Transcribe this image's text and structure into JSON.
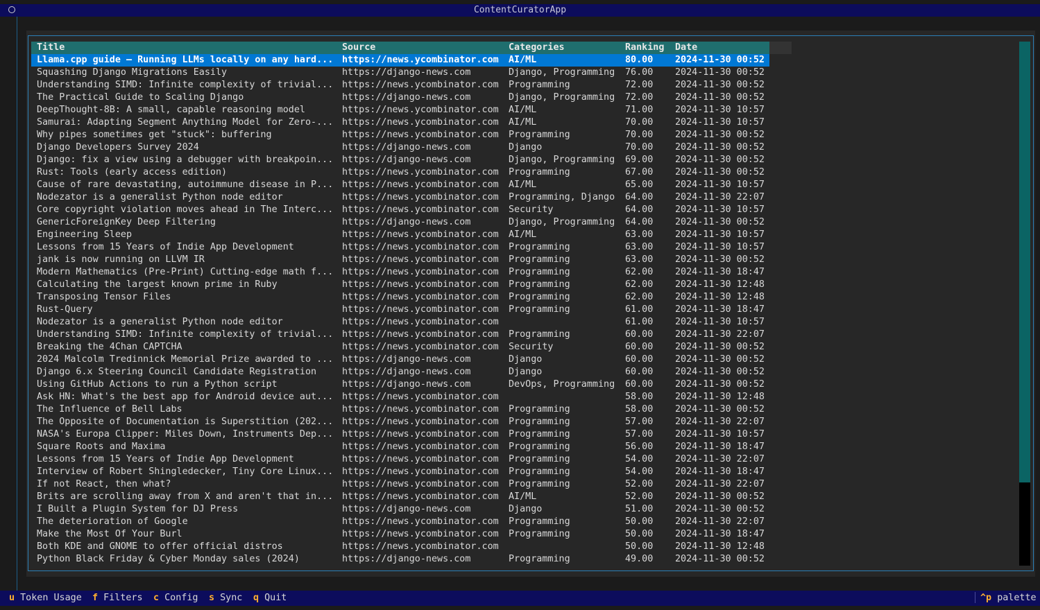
{
  "app": {
    "title": "ContentCuratorApp"
  },
  "table": {
    "columns": [
      "Title",
      "Source",
      "Categories",
      "Ranking",
      "Date"
    ],
    "selected_index": 0,
    "rows": [
      [
        "Llama.cpp guide – Running LLMs locally on any hard...",
        "https://news.ycombinator.com",
        "AI/ML",
        "80.00",
        "2024-11-30 00:52"
      ],
      [
        "Squashing Django Migrations Easily",
        "https://django-news.com",
        "Django, Programming",
        "76.00",
        "2024-11-30 00:52"
      ],
      [
        "Understanding SIMD: Infinite complexity of trivial...",
        "https://news.ycombinator.com",
        "Programming",
        "72.00",
        "2024-11-30 00:52"
      ],
      [
        "The Practical Guide to Scaling Django",
        "https://django-news.com",
        "Django, Programming",
        "72.00",
        "2024-11-30 00:52"
      ],
      [
        "DeepThought-8B: A small, capable reasoning model",
        "https://news.ycombinator.com",
        "AI/ML",
        "71.00",
        "2024-11-30 10:57"
      ],
      [
        "Samurai: Adapting Segment Anything Model for Zero-...",
        "https://news.ycombinator.com",
        "AI/ML",
        "70.00",
        "2024-11-30 10:57"
      ],
      [
        "Why pipes sometimes get \"stuck\": buffering",
        "https://news.ycombinator.com",
        "Programming",
        "70.00",
        "2024-11-30 00:52"
      ],
      [
        "Django Developers Survey 2024",
        "https://django-news.com",
        "Django",
        "70.00",
        "2024-11-30 00:52"
      ],
      [
        "Django: fix a view using a debugger with breakpoin...",
        "https://django-news.com",
        "Django, Programming",
        "69.00",
        "2024-11-30 00:52"
      ],
      [
        "Rust: Tools (early access edition)",
        "https://news.ycombinator.com",
        "Programming",
        "67.00",
        "2024-11-30 00:52"
      ],
      [
        "Cause of rare devastating, autoimmune disease in P...",
        "https://news.ycombinator.com",
        "AI/ML",
        "65.00",
        "2024-11-30 10:57"
      ],
      [
        "Nodezator is a generalist Python node editor",
        "https://news.ycombinator.com",
        "Programming, Django",
        "64.00",
        "2024-11-30 22:07"
      ],
      [
        "Core copyright violation moves ahead in The Interc...",
        "https://news.ycombinator.com",
        "Security",
        "64.00",
        "2024-11-30 10:57"
      ],
      [
        "GenericForeignKey Deep Filtering",
        "https://django-news.com",
        "Django, Programming",
        "64.00",
        "2024-11-30 00:52"
      ],
      [
        "Engineering Sleep",
        "https://news.ycombinator.com",
        "AI/ML",
        "63.00",
        "2024-11-30 10:57"
      ],
      [
        "Lessons from 15 Years of Indie App Development",
        "https://news.ycombinator.com",
        "Programming",
        "63.00",
        "2024-11-30 10:57"
      ],
      [
        "jank is now running on LLVM IR",
        "https://news.ycombinator.com",
        "Programming",
        "63.00",
        "2024-11-30 00:52"
      ],
      [
        "Modern Mathematics (Pre-Print) Cutting-edge math f...",
        "https://news.ycombinator.com",
        "Programming",
        "62.00",
        "2024-11-30 18:47"
      ],
      [
        "Calculating the largest known prime in Ruby",
        "https://news.ycombinator.com",
        "Programming",
        "62.00",
        "2024-11-30 12:48"
      ],
      [
        "Transposing Tensor Files",
        "https://news.ycombinator.com",
        "Programming",
        "62.00",
        "2024-11-30 12:48"
      ],
      [
        "Rust-Query",
        "https://news.ycombinator.com",
        "Programming",
        "61.00",
        "2024-11-30 18:47"
      ],
      [
        "Nodezator is a generalist Python node editor",
        "https://news.ycombinator.com",
        "",
        "61.00",
        "2024-11-30 10:57"
      ],
      [
        "Understanding SIMD: Infinite complexity of trivial...",
        "https://news.ycombinator.com",
        "Programming",
        "60.00",
        "2024-11-30 22:07"
      ],
      [
        "Breaking the 4Chan CAPTCHA",
        "https://news.ycombinator.com",
        "Security",
        "60.00",
        "2024-11-30 00:52"
      ],
      [
        "2024 Malcolm Tredinnick Memorial Prize awarded to ...",
        "https://django-news.com",
        "Django",
        "60.00",
        "2024-11-30 00:52"
      ],
      [
        "Django 6.x Steering Council Candidate Registration",
        "https://django-news.com",
        "Django",
        "60.00",
        "2024-11-30 00:52"
      ],
      [
        "Using GitHub Actions to run a Python script",
        "https://django-news.com",
        "DevOps, Programming",
        "60.00",
        "2024-11-30 00:52"
      ],
      [
        "Ask HN: What's the best app for Android device aut...",
        "https://news.ycombinator.com",
        "",
        "58.00",
        "2024-11-30 12:48"
      ],
      [
        "The Influence of Bell Labs",
        "https://news.ycombinator.com",
        "Programming",
        "58.00",
        "2024-11-30 00:52"
      ],
      [
        "The Opposite of Documentation is Superstition (202...",
        "https://news.ycombinator.com",
        "Programming",
        "57.00",
        "2024-11-30 22:07"
      ],
      [
        "NASA's Europa Clipper: Miles Down, Instruments Dep...",
        "https://news.ycombinator.com",
        "Programming",
        "57.00",
        "2024-11-30 10:57"
      ],
      [
        "Square Roots and Maxima",
        "https://news.ycombinator.com",
        "Programming",
        "56.00",
        "2024-11-30 18:47"
      ],
      [
        "Lessons from 15 Years of Indie App Development",
        "https://news.ycombinator.com",
        "Programming",
        "54.00",
        "2024-11-30 22:07"
      ],
      [
        "Interview of Robert Shingledecker, Tiny Core Linux...",
        "https://news.ycombinator.com",
        "Programming",
        "54.00",
        "2024-11-30 18:47"
      ],
      [
        "If not React, then what?",
        "https://news.ycombinator.com",
        "Programming",
        "52.00",
        "2024-11-30 22:07"
      ],
      [
        "Brits are scrolling away from X and aren't that in...",
        "https://news.ycombinator.com",
        "AI/ML",
        "52.00",
        "2024-11-30 00:52"
      ],
      [
        "I Built a Plugin System for DJ Press",
        "https://django-news.com",
        "Django",
        "51.00",
        "2024-11-30 00:52"
      ],
      [
        "The deterioration of Google",
        "https://news.ycombinator.com",
        "Programming",
        "50.00",
        "2024-11-30 22:07"
      ],
      [
        "Make the Most Of Your Burl",
        "https://news.ycombinator.com",
        "Programming",
        "50.00",
        "2024-11-30 18:47"
      ],
      [
        "Both KDE and GNOME to offer official distros",
        "https://news.ycombinator.com",
        "",
        "50.00",
        "2024-11-30 12:48"
      ],
      [
        "Python Black Friday & Cyber Monday sales (2024)",
        "https://django-news.com",
        "Programming",
        "49.00",
        "2024-11-30 00:52"
      ]
    ]
  },
  "footer": {
    "bindings": [
      {
        "key": "u",
        "label": "Token Usage"
      },
      {
        "key": "f",
        "label": "Filters"
      },
      {
        "key": "c",
        "label": "Config"
      },
      {
        "key": "s",
        "label": "Sync"
      },
      {
        "key": "q",
        "label": "Quit"
      }
    ],
    "palette": {
      "key": "^p",
      "label": "palette"
    }
  },
  "colors": {
    "titlebar_bg": "#0c0c5c",
    "header_bg": "#1f6e6e",
    "selected_row_bg": "#0178d4",
    "key_accent": "#ffb030"
  }
}
